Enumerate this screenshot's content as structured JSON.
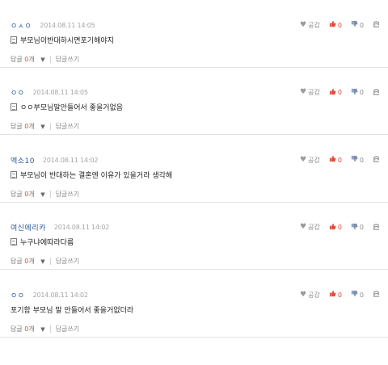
{
  "common": {
    "like_label": "공감",
    "reply_label": "답글",
    "reply_unit": "개",
    "write_reply_label": "답글쓰기",
    "icons": {
      "empathy": "heart-icon",
      "like": "thumbs-up-icon",
      "dislike": "thumbs-down-icon",
      "report": "report-icon",
      "memo": "document-icon",
      "toggle": "caret-down-icon"
    }
  },
  "comments": [
    {
      "author": "ㅇㅅㅇ",
      "date": "2014.08.11 14:05",
      "text": "부모님이반대하시면포기해야지",
      "likes": "0",
      "dislikes": "0",
      "replies": "0",
      "has_icon": true
    },
    {
      "author": "ㅇㅇ",
      "date": "2014.08.11 14:05",
      "text": "ㅇㅇ부모님말안들어서 좋을거없음",
      "likes": "0",
      "dislikes": "0",
      "replies": "0",
      "has_icon": true
    },
    {
      "author": "엑소10",
      "date": "2014.08.11 14:02",
      "text": "부모님이 반대하는 결혼엔 이유가 있을거라 생각해",
      "likes": "0",
      "dislikes": "0",
      "replies": "0",
      "has_icon": true
    },
    {
      "author": "여신에리카",
      "date": "2014.08.11 14:02",
      "text": "누구냐에따라다름",
      "likes": "0",
      "dislikes": "0",
      "replies": "0",
      "has_icon": true
    },
    {
      "author": "ㅇㅇ",
      "date": "2014.08.11 14:02",
      "text": "포기함 부모님 말 안들어서 좋을거없더라",
      "likes": "0",
      "dislikes": "0",
      "replies": "0",
      "has_icon": false
    }
  ]
}
